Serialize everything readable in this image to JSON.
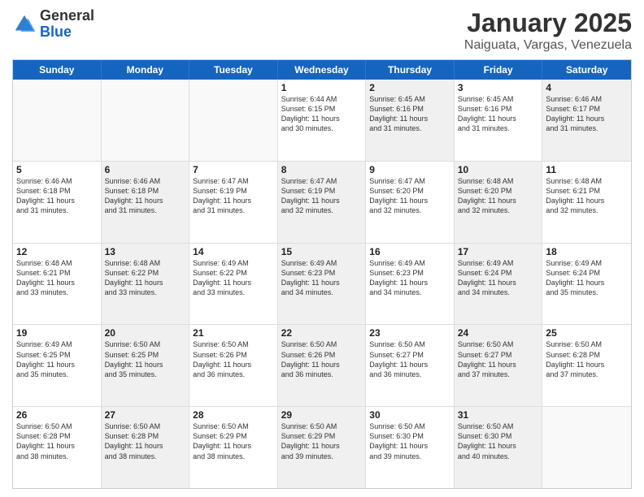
{
  "logo": {
    "general": "General",
    "blue": "Blue"
  },
  "title": "January 2025",
  "subtitle": "Naiguata, Vargas, Venezuela",
  "header_days": [
    "Sunday",
    "Monday",
    "Tuesday",
    "Wednesday",
    "Thursday",
    "Friday",
    "Saturday"
  ],
  "weeks": [
    [
      {
        "day": "",
        "info": "",
        "shaded": false,
        "empty": true
      },
      {
        "day": "",
        "info": "",
        "shaded": false,
        "empty": true
      },
      {
        "day": "",
        "info": "",
        "shaded": false,
        "empty": true
      },
      {
        "day": "1",
        "info": "Sunrise: 6:44 AM\nSunset: 6:15 PM\nDaylight: 11 hours\nand 30 minutes.",
        "shaded": false,
        "empty": false
      },
      {
        "day": "2",
        "info": "Sunrise: 6:45 AM\nSunset: 6:16 PM\nDaylight: 11 hours\nand 31 minutes.",
        "shaded": true,
        "empty": false
      },
      {
        "day": "3",
        "info": "Sunrise: 6:45 AM\nSunset: 6:16 PM\nDaylight: 11 hours\nand 31 minutes.",
        "shaded": false,
        "empty": false
      },
      {
        "day": "4",
        "info": "Sunrise: 6:46 AM\nSunset: 6:17 PM\nDaylight: 11 hours\nand 31 minutes.",
        "shaded": true,
        "empty": false
      }
    ],
    [
      {
        "day": "5",
        "info": "Sunrise: 6:46 AM\nSunset: 6:18 PM\nDaylight: 11 hours\nand 31 minutes.",
        "shaded": false,
        "empty": false
      },
      {
        "day": "6",
        "info": "Sunrise: 6:46 AM\nSunset: 6:18 PM\nDaylight: 11 hours\nand 31 minutes.",
        "shaded": true,
        "empty": false
      },
      {
        "day": "7",
        "info": "Sunrise: 6:47 AM\nSunset: 6:19 PM\nDaylight: 11 hours\nand 31 minutes.",
        "shaded": false,
        "empty": false
      },
      {
        "day": "8",
        "info": "Sunrise: 6:47 AM\nSunset: 6:19 PM\nDaylight: 11 hours\nand 32 minutes.",
        "shaded": true,
        "empty": false
      },
      {
        "day": "9",
        "info": "Sunrise: 6:47 AM\nSunset: 6:20 PM\nDaylight: 11 hours\nand 32 minutes.",
        "shaded": false,
        "empty": false
      },
      {
        "day": "10",
        "info": "Sunrise: 6:48 AM\nSunset: 6:20 PM\nDaylight: 11 hours\nand 32 minutes.",
        "shaded": true,
        "empty": false
      },
      {
        "day": "11",
        "info": "Sunrise: 6:48 AM\nSunset: 6:21 PM\nDaylight: 11 hours\nand 32 minutes.",
        "shaded": false,
        "empty": false
      }
    ],
    [
      {
        "day": "12",
        "info": "Sunrise: 6:48 AM\nSunset: 6:21 PM\nDaylight: 11 hours\nand 33 minutes.",
        "shaded": false,
        "empty": false
      },
      {
        "day": "13",
        "info": "Sunrise: 6:48 AM\nSunset: 6:22 PM\nDaylight: 11 hours\nand 33 minutes.",
        "shaded": true,
        "empty": false
      },
      {
        "day": "14",
        "info": "Sunrise: 6:49 AM\nSunset: 6:22 PM\nDaylight: 11 hours\nand 33 minutes.",
        "shaded": false,
        "empty": false
      },
      {
        "day": "15",
        "info": "Sunrise: 6:49 AM\nSunset: 6:23 PM\nDaylight: 11 hours\nand 34 minutes.",
        "shaded": true,
        "empty": false
      },
      {
        "day": "16",
        "info": "Sunrise: 6:49 AM\nSunset: 6:23 PM\nDaylight: 11 hours\nand 34 minutes.",
        "shaded": false,
        "empty": false
      },
      {
        "day": "17",
        "info": "Sunrise: 6:49 AM\nSunset: 6:24 PM\nDaylight: 11 hours\nand 34 minutes.",
        "shaded": true,
        "empty": false
      },
      {
        "day": "18",
        "info": "Sunrise: 6:49 AM\nSunset: 6:24 PM\nDaylight: 11 hours\nand 35 minutes.",
        "shaded": false,
        "empty": false
      }
    ],
    [
      {
        "day": "19",
        "info": "Sunrise: 6:49 AM\nSunset: 6:25 PM\nDaylight: 11 hours\nand 35 minutes.",
        "shaded": false,
        "empty": false
      },
      {
        "day": "20",
        "info": "Sunrise: 6:50 AM\nSunset: 6:25 PM\nDaylight: 11 hours\nand 35 minutes.",
        "shaded": true,
        "empty": false
      },
      {
        "day": "21",
        "info": "Sunrise: 6:50 AM\nSunset: 6:26 PM\nDaylight: 11 hours\nand 36 minutes.",
        "shaded": false,
        "empty": false
      },
      {
        "day": "22",
        "info": "Sunrise: 6:50 AM\nSunset: 6:26 PM\nDaylight: 11 hours\nand 36 minutes.",
        "shaded": true,
        "empty": false
      },
      {
        "day": "23",
        "info": "Sunrise: 6:50 AM\nSunset: 6:27 PM\nDaylight: 11 hours\nand 36 minutes.",
        "shaded": false,
        "empty": false
      },
      {
        "day": "24",
        "info": "Sunrise: 6:50 AM\nSunset: 6:27 PM\nDaylight: 11 hours\nand 37 minutes.",
        "shaded": true,
        "empty": false
      },
      {
        "day": "25",
        "info": "Sunrise: 6:50 AM\nSunset: 6:28 PM\nDaylight: 11 hours\nand 37 minutes.",
        "shaded": false,
        "empty": false
      }
    ],
    [
      {
        "day": "26",
        "info": "Sunrise: 6:50 AM\nSunset: 6:28 PM\nDaylight: 11 hours\nand 38 minutes.",
        "shaded": false,
        "empty": false
      },
      {
        "day": "27",
        "info": "Sunrise: 6:50 AM\nSunset: 6:28 PM\nDaylight: 11 hours\nand 38 minutes.",
        "shaded": true,
        "empty": false
      },
      {
        "day": "28",
        "info": "Sunrise: 6:50 AM\nSunset: 6:29 PM\nDaylight: 11 hours\nand 38 minutes.",
        "shaded": false,
        "empty": false
      },
      {
        "day": "29",
        "info": "Sunrise: 6:50 AM\nSunset: 6:29 PM\nDaylight: 11 hours\nand 39 minutes.",
        "shaded": true,
        "empty": false
      },
      {
        "day": "30",
        "info": "Sunrise: 6:50 AM\nSunset: 6:30 PM\nDaylight: 11 hours\nand 39 minutes.",
        "shaded": false,
        "empty": false
      },
      {
        "day": "31",
        "info": "Sunrise: 6:50 AM\nSunset: 6:30 PM\nDaylight: 11 hours\nand 40 minutes.",
        "shaded": true,
        "empty": false
      },
      {
        "day": "",
        "info": "",
        "shaded": false,
        "empty": true
      }
    ]
  ]
}
